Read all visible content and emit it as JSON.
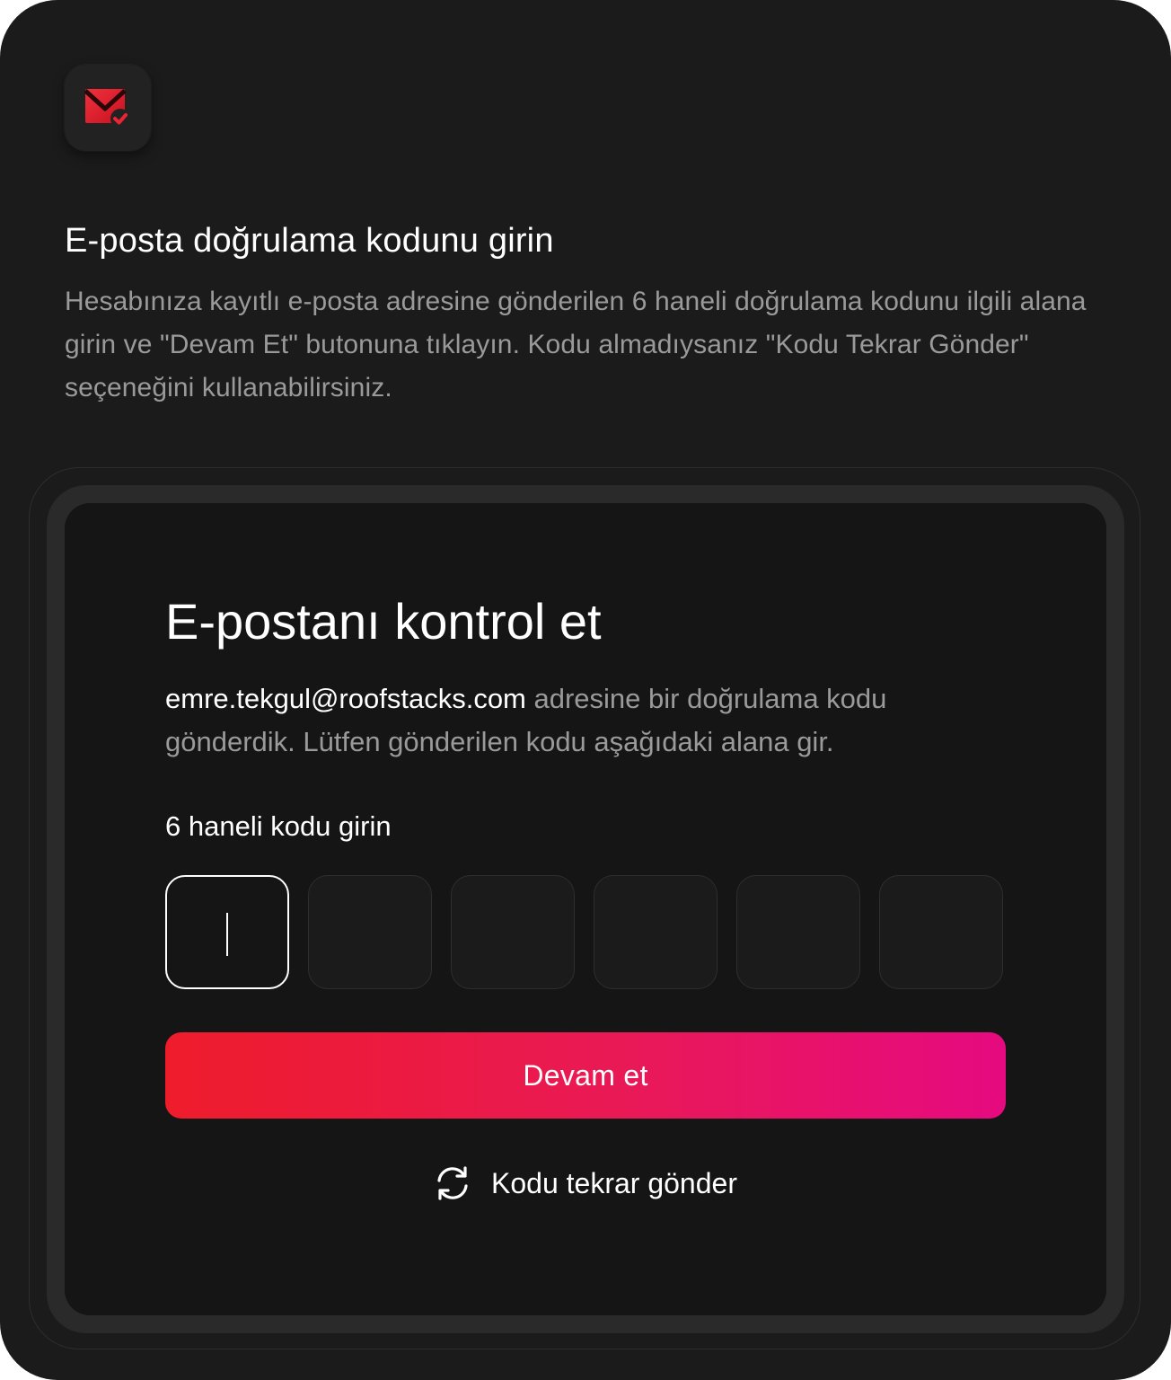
{
  "header": {
    "icon": "mail-check-icon",
    "title": "E-posta doğrulama kodunu girin",
    "description": "Hesabınıza kayıtlı e-posta adresine gönderilen 6 haneli doğrulama kodunu ilgili alana girin ve \"Devam Et\" butonuna tıklayın. Kodu almadıysanız \"Kodu Tekrar Gönder\" seçeneğini kullanabilirsiniz."
  },
  "form": {
    "title": "E-postanı kontrol et",
    "email": "emre.tekgul@roofstacks.com",
    "info_suffix": " adresine bir doğrulama kodu gönderdik. Lütfen gönderilen kodu aşağıdaki alana gir.",
    "code_label": "6 haneli kodu girin",
    "code_digits": [
      "",
      "",
      "",
      "",
      "",
      ""
    ],
    "active_digit_index": 0,
    "submit_label": "Devam et",
    "resend_label": "Kodu tekrar gönder",
    "resend_icon": "refresh-icon"
  },
  "colors": {
    "background": "#1b1b1b",
    "accent_start": "#ee1c2b",
    "accent_end": "#e60a80",
    "muted_text": "#9a9a9a"
  }
}
